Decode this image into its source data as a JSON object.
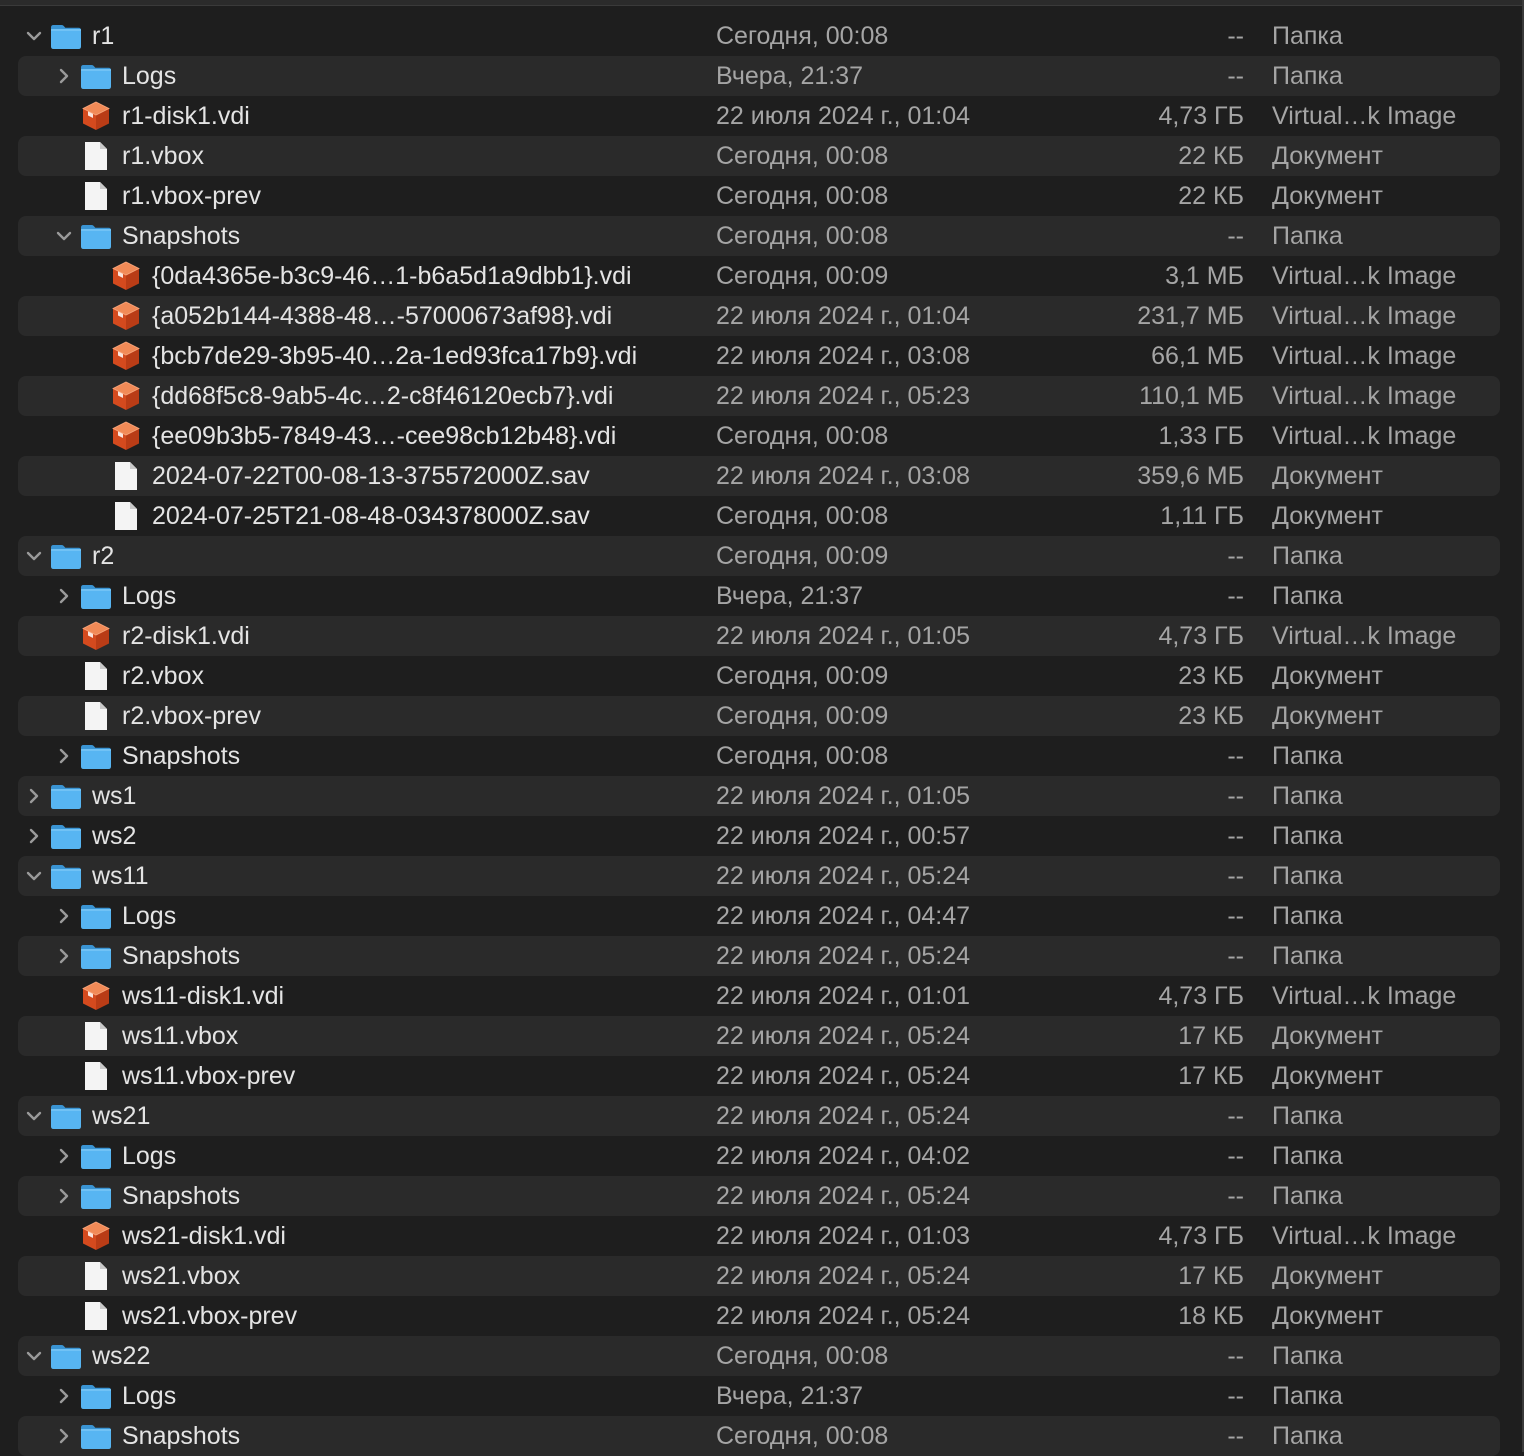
{
  "rows": [
    {
      "name": "r1",
      "date": "Сегодня, 00:08",
      "size": "--",
      "kind": "Папка",
      "icon": "folder-icon",
      "depth": 0,
      "disclosure": "expanded"
    },
    {
      "name": "Logs",
      "date": "Вчера, 21:37",
      "size": "--",
      "kind": "Папка",
      "icon": "folder-icon",
      "depth": 1,
      "disclosure": "collapsed"
    },
    {
      "name": "r1-disk1.vdi",
      "date": "22 июля 2024 г., 01:04",
      "size": "4,73 ГБ",
      "kind": "Virtual…k Image",
      "icon": "virtual-disk-icon",
      "depth": 1,
      "disclosure": "none"
    },
    {
      "name": "r1.vbox",
      "date": "Сегодня, 00:08",
      "size": "22 КБ",
      "kind": "Документ",
      "icon": "document-icon",
      "depth": 1,
      "disclosure": "none"
    },
    {
      "name": "r1.vbox-prev",
      "date": "Сегодня, 00:08",
      "size": "22 КБ",
      "kind": "Документ",
      "icon": "document-icon",
      "depth": 1,
      "disclosure": "none"
    },
    {
      "name": "Snapshots",
      "date": "Сегодня, 00:08",
      "size": "--",
      "kind": "Папка",
      "icon": "folder-icon",
      "depth": 1,
      "disclosure": "expanded"
    },
    {
      "name": "{0da4365e-b3c9-46…1-b6a5d1a9dbb1}.vdi",
      "date": "Сегодня, 00:09",
      "size": "3,1 МБ",
      "kind": "Virtual…k Image",
      "icon": "virtual-disk-icon",
      "depth": 2,
      "disclosure": "none"
    },
    {
      "name": "{a052b144-4388-48…-57000673af98}.vdi",
      "date": "22 июля 2024 г., 01:04",
      "size": "231,7 МБ",
      "kind": "Virtual…k Image",
      "icon": "virtual-disk-icon",
      "depth": 2,
      "disclosure": "none"
    },
    {
      "name": "{bcb7de29-3b95-40…2a-1ed93fca17b9}.vdi",
      "date": "22 июля 2024 г., 03:08",
      "size": "66,1 МБ",
      "kind": "Virtual…k Image",
      "icon": "virtual-disk-icon",
      "depth": 2,
      "disclosure": "none"
    },
    {
      "name": "{dd68f5c8-9ab5-4c…2-c8f46120ecb7}.vdi",
      "date": "22 июля 2024 г., 05:23",
      "size": "110,1 МБ",
      "kind": "Virtual…k Image",
      "icon": "virtual-disk-icon",
      "depth": 2,
      "disclosure": "none"
    },
    {
      "name": "{ee09b3b5-7849-43…-cee98cb12b48}.vdi",
      "date": "Сегодня, 00:08",
      "size": "1,33 ГБ",
      "kind": "Virtual…k Image",
      "icon": "virtual-disk-icon",
      "depth": 2,
      "disclosure": "none"
    },
    {
      "name": "2024-07-22T00-08-13-375572000Z.sav",
      "date": "22 июля 2024 г., 03:08",
      "size": "359,6 МБ",
      "kind": "Документ",
      "icon": "document-icon",
      "depth": 2,
      "disclosure": "none"
    },
    {
      "name": "2024-07-25T21-08-48-034378000Z.sav",
      "date": "Сегодня, 00:08",
      "size": "1,11 ГБ",
      "kind": "Документ",
      "icon": "document-icon",
      "depth": 2,
      "disclosure": "none"
    },
    {
      "name": "r2",
      "date": "Сегодня, 00:09",
      "size": "--",
      "kind": "Папка",
      "icon": "folder-icon",
      "depth": 0,
      "disclosure": "expanded"
    },
    {
      "name": "Logs",
      "date": "Вчера, 21:37",
      "size": "--",
      "kind": "Папка",
      "icon": "folder-icon",
      "depth": 1,
      "disclosure": "collapsed"
    },
    {
      "name": "r2-disk1.vdi",
      "date": "22 июля 2024 г., 01:05",
      "size": "4,73 ГБ",
      "kind": "Virtual…k Image",
      "icon": "virtual-disk-icon",
      "depth": 1,
      "disclosure": "none"
    },
    {
      "name": "r2.vbox",
      "date": "Сегодня, 00:09",
      "size": "23 КБ",
      "kind": "Документ",
      "icon": "document-icon",
      "depth": 1,
      "disclosure": "none"
    },
    {
      "name": "r2.vbox-prev",
      "date": "Сегодня, 00:09",
      "size": "23 КБ",
      "kind": "Документ",
      "icon": "document-icon",
      "depth": 1,
      "disclosure": "none"
    },
    {
      "name": "Snapshots",
      "date": "Сегодня, 00:08",
      "size": "--",
      "kind": "Папка",
      "icon": "folder-icon",
      "depth": 1,
      "disclosure": "collapsed"
    },
    {
      "name": "ws1",
      "date": "22 июля 2024 г., 01:05",
      "size": "--",
      "kind": "Папка",
      "icon": "folder-icon",
      "depth": 0,
      "disclosure": "collapsed"
    },
    {
      "name": "ws2",
      "date": "22 июля 2024 г., 00:57",
      "size": "--",
      "kind": "Папка",
      "icon": "folder-icon",
      "depth": 0,
      "disclosure": "collapsed"
    },
    {
      "name": "ws11",
      "date": "22 июля 2024 г., 05:24",
      "size": "--",
      "kind": "Папка",
      "icon": "folder-icon",
      "depth": 0,
      "disclosure": "expanded"
    },
    {
      "name": "Logs",
      "date": "22 июля 2024 г., 04:47",
      "size": "--",
      "kind": "Папка",
      "icon": "folder-icon",
      "depth": 1,
      "disclosure": "collapsed"
    },
    {
      "name": "Snapshots",
      "date": "22 июля 2024 г., 05:24",
      "size": "--",
      "kind": "Папка",
      "icon": "folder-icon",
      "depth": 1,
      "disclosure": "collapsed"
    },
    {
      "name": "ws11-disk1.vdi",
      "date": "22 июля 2024 г., 01:01",
      "size": "4,73 ГБ",
      "kind": "Virtual…k Image",
      "icon": "virtual-disk-icon",
      "depth": 1,
      "disclosure": "none"
    },
    {
      "name": "ws11.vbox",
      "date": "22 июля 2024 г., 05:24",
      "size": "17 КБ",
      "kind": "Документ",
      "icon": "document-icon",
      "depth": 1,
      "disclosure": "none"
    },
    {
      "name": "ws11.vbox-prev",
      "date": "22 июля 2024 г., 05:24",
      "size": "17 КБ",
      "kind": "Документ",
      "icon": "document-icon",
      "depth": 1,
      "disclosure": "none"
    },
    {
      "name": "ws21",
      "date": "22 июля 2024 г., 05:24",
      "size": "--",
      "kind": "Папка",
      "icon": "folder-icon",
      "depth": 0,
      "disclosure": "expanded"
    },
    {
      "name": "Logs",
      "date": "22 июля 2024 г., 04:02",
      "size": "--",
      "kind": "Папка",
      "icon": "folder-icon",
      "depth": 1,
      "disclosure": "collapsed"
    },
    {
      "name": "Snapshots",
      "date": "22 июля 2024 г., 05:24",
      "size": "--",
      "kind": "Папка",
      "icon": "folder-icon",
      "depth": 1,
      "disclosure": "collapsed"
    },
    {
      "name": "ws21-disk1.vdi",
      "date": "22 июля 2024 г., 01:03",
      "size": "4,73 ГБ",
      "kind": "Virtual…k Image",
      "icon": "virtual-disk-icon",
      "depth": 1,
      "disclosure": "none"
    },
    {
      "name": "ws21.vbox",
      "date": "22 июля 2024 г., 05:24",
      "size": "17 КБ",
      "kind": "Документ",
      "icon": "document-icon",
      "depth": 1,
      "disclosure": "none"
    },
    {
      "name": "ws21.vbox-prev",
      "date": "22 июля 2024 г., 05:24",
      "size": "18 КБ",
      "kind": "Документ",
      "icon": "document-icon",
      "depth": 1,
      "disclosure": "none"
    },
    {
      "name": "ws22",
      "date": "Сегодня, 00:08",
      "size": "--",
      "kind": "Папка",
      "icon": "folder-icon",
      "depth": 0,
      "disclosure": "expanded"
    },
    {
      "name": "Logs",
      "date": "Вчера, 21:37",
      "size": "--",
      "kind": "Папка",
      "icon": "folder-icon",
      "depth": 1,
      "disclosure": "collapsed"
    },
    {
      "name": "Snapshots",
      "date": "Сегодня, 00:08",
      "size": "--",
      "kind": "Папка",
      "icon": "folder-icon",
      "depth": 1,
      "disclosure": "collapsed"
    }
  ],
  "colors": {
    "background": "#1e1e1e",
    "stripe": "#2a2a2a",
    "folder": "#52b3f0",
    "vdi": "#e0582a",
    "text_primary": "#e4e4e4",
    "text_secondary": "#a5a5a5"
  }
}
